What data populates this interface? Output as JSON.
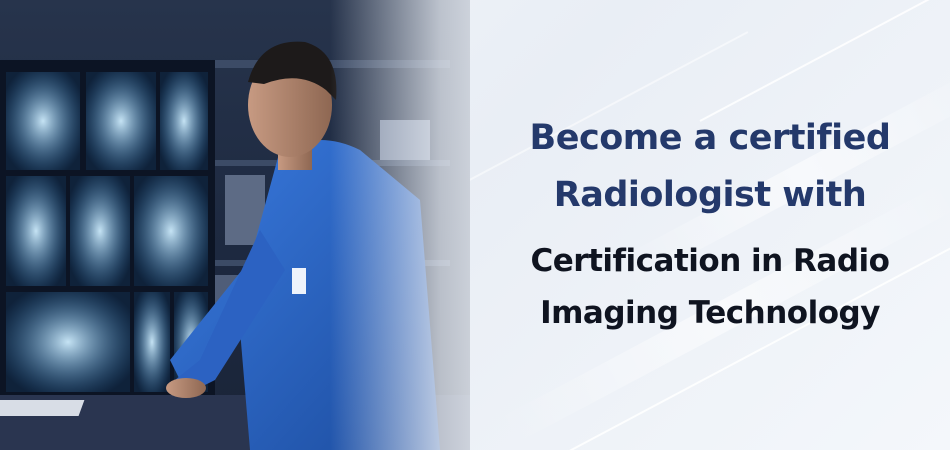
{
  "banner": {
    "headline": [
      "Become a certified",
      "Radiologist with"
    ],
    "subheadline": [
      "Certification in Radio",
      "Imaging Technology"
    ]
  },
  "colors": {
    "headline": "#24396b",
    "subheadline": "#0f1420",
    "background": "#eef2f8",
    "scan_glow": "#8fd6ff",
    "coat": "#2f6fd0"
  },
  "image": {
    "subject": "radiologist-reviewing-xray-scans-photo"
  }
}
